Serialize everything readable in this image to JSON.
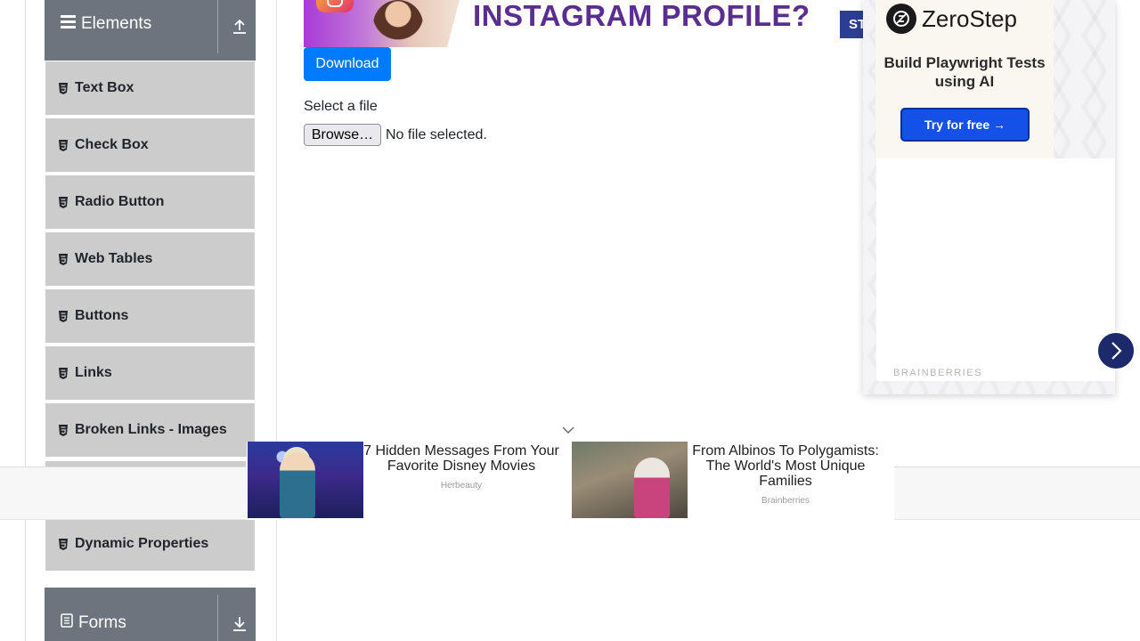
{
  "sidebar": {
    "elements_group": {
      "title": "Elements"
    },
    "items": [
      {
        "label": "Text Box"
      },
      {
        "label": "Check Box"
      },
      {
        "label": "Radio Button"
      },
      {
        "label": "Web Tables"
      },
      {
        "label": "Buttons"
      },
      {
        "label": "Links"
      },
      {
        "label": "Broken Links - Images"
      },
      {
        "label": "Dynamic Properties"
      }
    ],
    "forms_group": {
      "title": "Forms"
    }
  },
  "banner": {
    "headline": "INSTAGRAM PROFILE?",
    "cta": "ST"
  },
  "main": {
    "download_label": "Download",
    "upload_label": "Select a file",
    "browse_label": "Browse…",
    "file_status": "No file selected."
  },
  "right_ad": {
    "brand_name": "ZeroStep",
    "tagline": "Build Playwright Tests using AI",
    "cta": "Try for free →",
    "network": "BRAINBERRIES"
  },
  "bottom_ad": {
    "cards": [
      {
        "headline": "7 Hidden Messages From Your Favorite Disney Movies",
        "source": "Herbeauty"
      },
      {
        "headline": "From Albinos To Polygamists: The World's Most Unique Families",
        "source": "Brainberries"
      }
    ]
  },
  "colors": {
    "sidebar_header": "#6c757d",
    "sidebar_item": "#cccccc",
    "primary_button": "#007bff",
    "zerostep_cta": "#1451e8",
    "next_arrow": "#1c2a6b"
  }
}
